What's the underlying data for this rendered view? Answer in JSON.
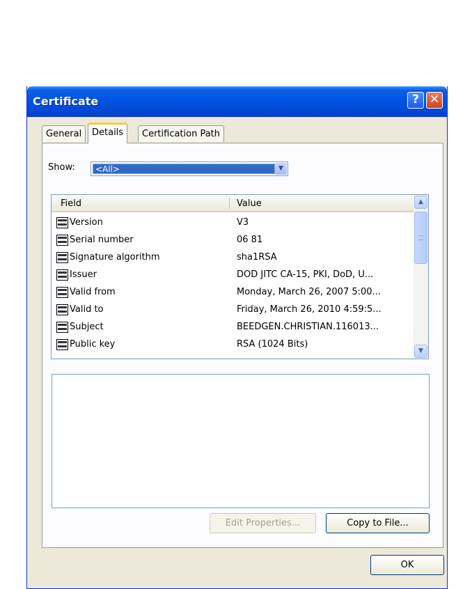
{
  "window": {
    "title": "Certificate",
    "help_glyph": "?",
    "close_glyph": "✕"
  },
  "tabs": [
    {
      "label": "General",
      "active": false
    },
    {
      "label": "Details",
      "active": true
    },
    {
      "label": "Certification Path",
      "active": false
    }
  ],
  "show": {
    "label": "Show:",
    "value": "<All>",
    "arrow": "▼"
  },
  "fields_table": {
    "columns": [
      "Field",
      "Value"
    ],
    "rows": [
      {
        "field": "Version",
        "value": "V3"
      },
      {
        "field": "Serial number",
        "value": "06 81"
      },
      {
        "field": "Signature algorithm",
        "value": "sha1RSA"
      },
      {
        "field": "Issuer",
        "value": "DOD JITC CA-15, PKI, DoD, U..."
      },
      {
        "field": "Valid from",
        "value": "Monday, March 26, 2007 5:00..."
      },
      {
        "field": "Valid to",
        "value": "Friday, March 26, 2010 4:59:5..."
      },
      {
        "field": "Subject",
        "value": "BEEDGEN.CHRISTIAN.116013..."
      },
      {
        "field": "Public key",
        "value": "RSA (1024 Bits)"
      }
    ],
    "row_icon": "certificate-field-icon",
    "scroll_up": "▲",
    "scroll_down": "▼"
  },
  "detail_text": "",
  "buttons": {
    "edit_properties": "Edit Properties...",
    "copy_to_file": "Copy to File...",
    "ok": "OK"
  },
  "colors": {
    "titlebar": "#0054e3",
    "selection": "#316ac5",
    "tab_highlight": "#ffc83c",
    "dialog_face": "#ece9d8"
  }
}
